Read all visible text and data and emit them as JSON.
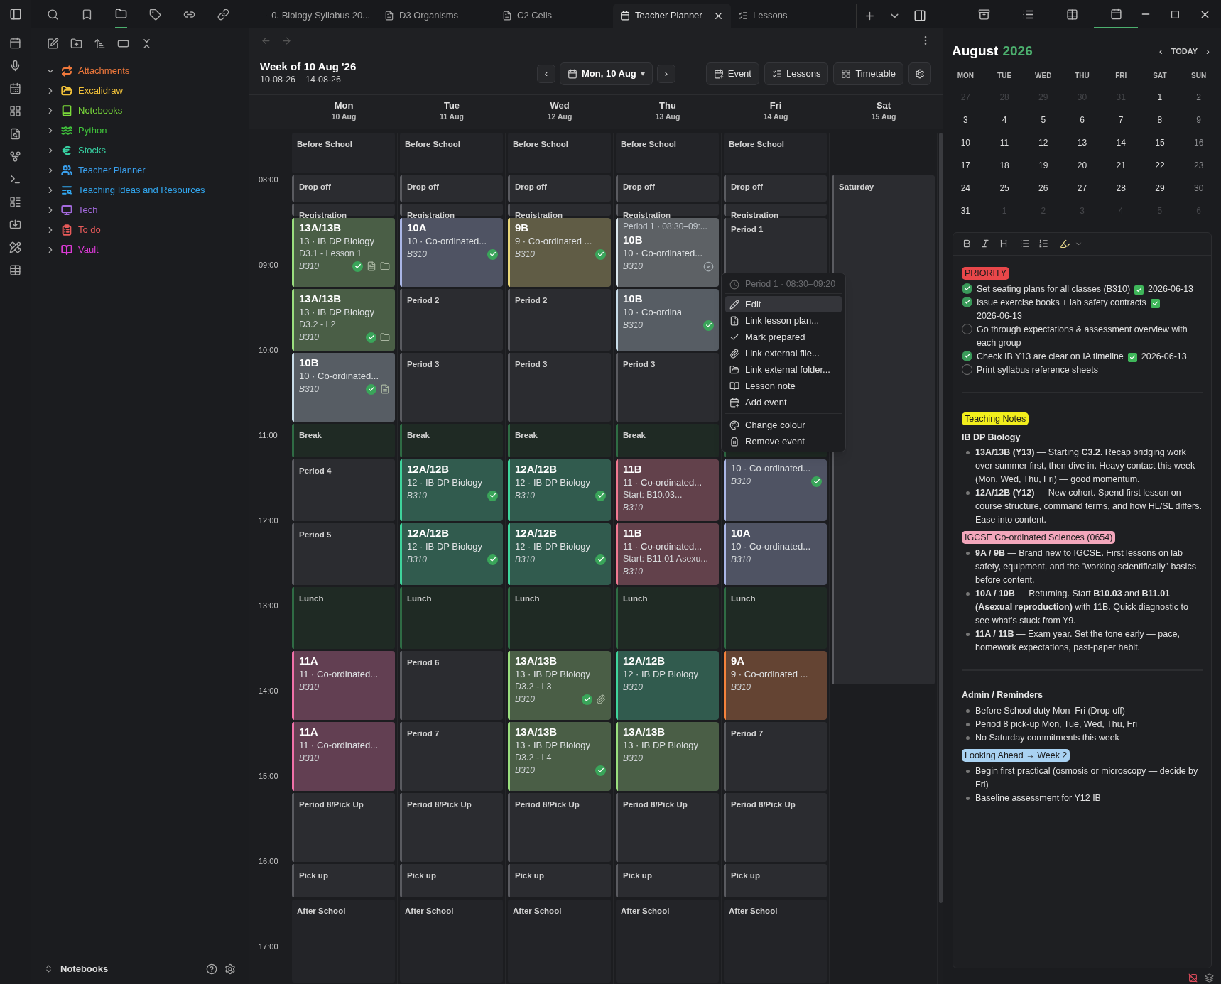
{
  "sidebar": {
    "items": [
      {
        "label": "Attachments",
        "kind": "attachments",
        "color": "#f0793c",
        "expanded": true
      },
      {
        "label": "Excalidraw",
        "kind": "folder",
        "color": "#f2c23a",
        "expanded": false
      },
      {
        "label": "Notebooks",
        "kind": "book",
        "color": "#7bdc3a",
        "expanded": false
      },
      {
        "label": "Python",
        "kind": "waves",
        "color": "#40c53c",
        "expanded": false
      },
      {
        "label": "Stocks",
        "kind": "euro",
        "color": "#38d3a4",
        "expanded": false
      },
      {
        "label": "Teacher Planner",
        "kind": "users",
        "color": "#3aa0ee",
        "expanded": false
      },
      {
        "label": "Teaching Ideas and Resources",
        "kind": "list",
        "color": "#32a6ee",
        "expanded": false
      },
      {
        "label": "Tech",
        "kind": "monitor",
        "color": "#a46ade",
        "expanded": false
      },
      {
        "label": "To do",
        "kind": "clipboard",
        "color": "#e85a5a",
        "expanded": false
      },
      {
        "label": "Vault",
        "kind": "bookopen",
        "color": "#dc3ad6",
        "expanded": false
      }
    ],
    "footer": "Notebooks"
  },
  "tabs": [
    {
      "label": "0. Biology Syllabus 20...",
      "kind": "file",
      "selected": false
    },
    {
      "label": "D3 Organisms",
      "kind": "file",
      "selected": false
    },
    {
      "label": "C2 Cells",
      "kind": "file",
      "selected": false
    },
    {
      "label": "Teacher Planner",
      "kind": "calendar",
      "selected": true
    },
    {
      "label": "Lessons",
      "kind": "tasks",
      "selected": false
    }
  ],
  "planner": {
    "title": "Week of 10 Aug '26",
    "range": "10-08-26 – 14-08-26",
    "prev": "‹",
    "date": "Mon, 10 Aug",
    "next": "›",
    "actions": [
      {
        "label": "Event",
        "kind": "event"
      },
      {
        "label": "Lessons",
        "kind": "tasks"
      },
      {
        "label": "Timetable",
        "kind": "grid"
      }
    ],
    "times": [
      "08:00",
      "09:00",
      "10:00",
      "11:00",
      "12:00",
      "13:00",
      "14:00",
      "15:00",
      "16:00",
      "17:00"
    ],
    "days": [
      {
        "name": "Mon",
        "date": "10 Aug",
        "kind": "weekday",
        "slots": [
          {
            "kind": "open",
            "label": "Before School"
          },
          {
            "kind": "duty",
            "label": "Drop off"
          },
          {
            "kind": "duty",
            "label": "Registration"
          },
          {
            "kind": "lesson",
            "title": "13A/13B",
            "subject": "13 · IB DP Biology",
            "detail": "D3.1 - Lesson 1",
            "room": "B310",
            "color": "#9ade7e",
            "prepared": true,
            "lesson_plan": true,
            "folder": true
          },
          {
            "kind": "lesson",
            "title": "13A/13B",
            "subject": "13 · IB DP Biology",
            "detail": "D3.2 - L2",
            "room": "B310",
            "color": "#9ade7e",
            "prepared": true,
            "folder": true
          },
          {
            "kind": "lesson",
            "title": "10B",
            "subject": "10 · Co-ordinated...",
            "room": "B310",
            "color": "#c8dce8",
            "prepared": true,
            "lesson_plan": true
          },
          {
            "kind": "break",
            "label": "Break"
          },
          {
            "kind": "duty",
            "label": "Period 4"
          },
          {
            "kind": "duty",
            "label": "Period 5"
          },
          {
            "kind": "break",
            "label": "Lunch"
          },
          {
            "kind": "lesson",
            "title": "11A",
            "subject": "11 · Co-ordinated...",
            "room": "B310",
            "color": "#f070a8"
          },
          {
            "kind": "lesson",
            "title": "11A",
            "subject": "11 · Co-ordinated...",
            "room": "B310",
            "color": "#f070a8"
          },
          {
            "kind": "duty",
            "label": "Period 8/Pick Up"
          },
          {
            "kind": "duty",
            "label": "Pick up"
          },
          {
            "kind": "open",
            "label": "After School"
          }
        ]
      },
      {
        "name": "Tue",
        "date": "11 Aug",
        "kind": "weekday",
        "slots": [
          {
            "kind": "open",
            "label": "Before School"
          },
          {
            "kind": "duty",
            "label": "Drop off"
          },
          {
            "kind": "duty",
            "label": "Registration"
          },
          {
            "kind": "lesson",
            "title": "10A",
            "subject": "10 · Co-ordinated...",
            "room": "B310",
            "color": "#aab6e6",
            "prepared": true
          },
          {
            "kind": "duty",
            "label": "Period 2"
          },
          {
            "kind": "duty",
            "label": "Period 3"
          },
          {
            "kind": "break",
            "label": "Break"
          },
          {
            "kind": "lesson",
            "title": "12A/12B",
            "subject": "12 · IB DP Biology",
            "room": "B310",
            "color": "#3fd49c",
            "prepared": true
          },
          {
            "kind": "lesson",
            "title": "12A/12B",
            "subject": "12 · IB DP Biology",
            "room": "B310",
            "color": "#3fd49c",
            "prepared": true
          },
          {
            "kind": "break",
            "label": "Lunch"
          },
          {
            "kind": "duty",
            "label": "Period 6"
          },
          {
            "kind": "duty",
            "label": "Period 7"
          },
          {
            "kind": "duty",
            "label": "Period 8/Pick Up"
          },
          {
            "kind": "duty",
            "label": "Pick up"
          },
          {
            "kind": "open",
            "label": "After School"
          }
        ]
      },
      {
        "name": "Wed",
        "date": "12 Aug",
        "kind": "weekday",
        "slots": [
          {
            "kind": "open",
            "label": "Before School"
          },
          {
            "kind": "duty",
            "label": "Drop off"
          },
          {
            "kind": "duty",
            "label": "Registration"
          },
          {
            "kind": "lesson",
            "title": "9B",
            "subject": "9 · Co-ordinated ...",
            "room": "B310",
            "color": "#e8d67a",
            "prepared": true
          },
          {
            "kind": "duty",
            "label": "Period 2"
          },
          {
            "kind": "duty",
            "label": "Period 3"
          },
          {
            "kind": "break",
            "label": "Break"
          },
          {
            "kind": "lesson",
            "title": "12A/12B",
            "subject": "12 · IB DP Biology",
            "room": "B310",
            "color": "#3fd49c",
            "prepared": true
          },
          {
            "kind": "lesson",
            "title": "12A/12B",
            "subject": "12 · IB DP Biology",
            "room": "B310",
            "color": "#3fd49c",
            "prepared": true
          },
          {
            "kind": "break",
            "label": "Lunch"
          },
          {
            "kind": "lesson",
            "title": "13A/13B",
            "subject": "13 · IB DP Biology",
            "detail": "D3.2 - L3",
            "room": "B310",
            "color": "#9ade7e",
            "prepared": true,
            "file": true
          },
          {
            "kind": "lesson",
            "title": "13A/13B",
            "subject": "13 · IB DP Biology",
            "detail": "D3.2 - L4",
            "room": "B310",
            "color": "#9ade7e",
            "prepared": true
          },
          {
            "kind": "duty",
            "label": "Period 8/Pick Up"
          },
          {
            "kind": "duty",
            "label": "Pick up"
          },
          {
            "kind": "open",
            "label": "After School"
          }
        ]
      },
      {
        "name": "Thu",
        "date": "13 Aug",
        "kind": "weekday",
        "slots": [
          {
            "kind": "open",
            "label": "Before School"
          },
          {
            "kind": "duty",
            "label": "Drop off"
          },
          {
            "kind": "duty",
            "label": "Registration"
          },
          {
            "kind": "lesson",
            "header": "Period 1 · 08:30–09:...",
            "title": "10B",
            "subject": "10 · Co-ordinated...",
            "room": "B310",
            "color": "#dce8ee",
            "prepared": false
          },
          {
            "kind": "lesson",
            "title": "10B",
            "subject": "10 · Co-ordina",
            "room": "B310",
            "color": "#c8dce8",
            "prepared": true
          },
          {
            "kind": "duty",
            "label": "Period 3"
          },
          {
            "kind": "break",
            "label": "Break"
          },
          {
            "kind": "lesson",
            "title": "11B",
            "subject": "11 · Co-ordinated...",
            "detail": "Start: B10.03...",
            "room": "B310",
            "color": "#f07890"
          },
          {
            "kind": "lesson",
            "title": "11B",
            "subject": "11 · Co-ordinated...",
            "detail": "Start: B11.01 Asexu...",
            "room": "B310",
            "color": "#f07890"
          },
          {
            "kind": "break",
            "label": "Lunch"
          },
          {
            "kind": "lesson",
            "title": "12A/12B",
            "subject": "12 · IB DP Biology",
            "room": "B310",
            "color": "#3fd49c"
          },
          {
            "kind": "lesson",
            "title": "13A/13B",
            "subject": "13 · IB DP Biology",
            "room": "B310",
            "color": "#9ade7e"
          },
          {
            "kind": "duty",
            "label": "Period 8/Pick Up"
          },
          {
            "kind": "duty",
            "label": "Pick up"
          },
          {
            "kind": "open",
            "label": "After School"
          }
        ]
      },
      {
        "name": "Fri",
        "date": "14 Aug",
        "kind": "weekday",
        "slots": [
          {
            "kind": "open",
            "label": "Before School"
          },
          {
            "kind": "duty",
            "label": "Drop off"
          },
          {
            "kind": "duty",
            "label": "Registration"
          },
          {
            "kind": "duty",
            "label": "Period 1"
          },
          {
            "kind": "covered"
          },
          {
            "kind": "covered"
          },
          {
            "kind": "break"
          },
          {
            "kind": "lesson",
            "subject": "10 · Co-ordinated...",
            "room": "B310",
            "color": "#aab6e6",
            "prepared": true
          },
          {
            "kind": "lesson",
            "title": "10A",
            "subject": "10 · Co-ordinated...",
            "room": "B310",
            "color": "#aab6e6"
          },
          {
            "kind": "break",
            "label": "Lunch"
          },
          {
            "kind": "lesson",
            "title": "9A",
            "subject": "9 · Co-ordinated ...",
            "room": "B310",
            "color": "#f5823c"
          },
          {
            "kind": "duty",
            "label": "Period 7"
          },
          {
            "kind": "duty",
            "label": "Period 8/Pick Up"
          },
          {
            "kind": "duty",
            "label": "Pick up"
          },
          {
            "kind": "open",
            "label": "After School"
          }
        ]
      },
      {
        "name": "Sat",
        "date": "15 Aug",
        "kind": "weekend",
        "slots": [
          {
            "kind": "duty",
            "label": "Saturday"
          }
        ]
      }
    ],
    "menu": {
      "header": "Period 1 · 08:30–09:20",
      "groups": [
        [
          {
            "label": "Edit",
            "kind": "edit",
            "selected": true
          },
          {
            "label": "Link lesson plan...",
            "kind": "plan",
            "selected": false
          },
          {
            "label": "Mark prepared",
            "kind": "check",
            "selected": false
          },
          {
            "label": "Link external file...",
            "kind": "file",
            "selected": false
          },
          {
            "label": "Link external folder...",
            "kind": "folder",
            "selected": false
          },
          {
            "label": "Lesson note",
            "kind": "note",
            "selected": false
          },
          {
            "label": "Add event",
            "kind": "event",
            "selected": false
          }
        ],
        [
          {
            "label": "Change colour",
            "kind": "colour",
            "selected": false
          },
          {
            "label": "Remove event",
            "kind": "remove",
            "selected": false
          }
        ]
      ]
    }
  },
  "calendar": {
    "month": "August",
    "year": "2026",
    "today": "TODAY",
    "prev": "‹",
    "next": "›",
    "weekdays": [
      "MON",
      "TUE",
      "WED",
      "THU",
      "FRI",
      "SAT",
      "SUN"
    ],
    "weeks": [
      [
        {
          "day": "27",
          "kind": "other"
        },
        {
          "day": "28",
          "kind": "other"
        },
        {
          "day": "29",
          "kind": "other"
        },
        {
          "day": "30",
          "kind": "other"
        },
        {
          "day": "31",
          "kind": "other"
        },
        {
          "day": "1",
          "kind": "current"
        },
        {
          "day": "2",
          "kind": "weekend"
        }
      ],
      [
        {
          "day": "3",
          "kind": "current"
        },
        {
          "day": "4",
          "kind": "current"
        },
        {
          "day": "5",
          "kind": "current"
        },
        {
          "day": "6",
          "kind": "current"
        },
        {
          "day": "7",
          "kind": "current"
        },
        {
          "day": "8",
          "kind": "current"
        },
        {
          "day": "9",
          "kind": "weekend"
        }
      ],
      [
        {
          "day": "10",
          "kind": "current"
        },
        {
          "day": "11",
          "kind": "current"
        },
        {
          "day": "12",
          "kind": "current"
        },
        {
          "day": "13",
          "kind": "current"
        },
        {
          "day": "14",
          "kind": "current"
        },
        {
          "day": "15",
          "kind": "current"
        },
        {
          "day": "16",
          "kind": "weekend"
        }
      ],
      [
        {
          "day": "17",
          "kind": "current"
        },
        {
          "day": "18",
          "kind": "current"
        },
        {
          "day": "19",
          "kind": "current"
        },
        {
          "day": "20",
          "kind": "current"
        },
        {
          "day": "21",
          "kind": "current"
        },
        {
          "day": "22",
          "kind": "current"
        },
        {
          "day": "23",
          "kind": "weekend"
        }
      ],
      [
        {
          "day": "24",
          "kind": "current"
        },
        {
          "day": "25",
          "kind": "current"
        },
        {
          "day": "26",
          "kind": "current"
        },
        {
          "day": "27",
          "kind": "current"
        },
        {
          "day": "28",
          "kind": "current"
        },
        {
          "day": "29",
          "kind": "current"
        },
        {
          "day": "30",
          "kind": "weekend"
        }
      ],
      [
        {
          "day": "31",
          "kind": "current"
        },
        {
          "day": "1",
          "kind": "other"
        },
        {
          "day": "2",
          "kind": "other"
        },
        {
          "day": "3",
          "kind": "other"
        },
        {
          "day": "4",
          "kind": "other"
        },
        {
          "day": "5",
          "kind": "other"
        },
        {
          "day": "6",
          "kind": "other"
        }
      ]
    ]
  },
  "note": {
    "blocks": [
      {
        "kind": "tag",
        "text": "PRIORITY",
        "color": "#e8474a"
      },
      {
        "kind": "task",
        "text": "Set seating plans for all classes (B310)",
        "checked": true,
        "date": "2026-06-13"
      },
      {
        "kind": "task",
        "text": "Issue exercise books + lab safety contracts",
        "checked": true,
        "date": "2026-06-13"
      },
      {
        "kind": "task",
        "text": "Go through expectations & assessment overview with each group",
        "checked": false
      },
      {
        "kind": "task",
        "text": "Check IB Y13 are clear on IA timeline",
        "checked": true,
        "date": "2026-06-13"
      },
      {
        "kind": "task",
        "text": "Print syllabus reference sheets",
        "checked": false
      },
      {
        "kind": "divider"
      },
      {
        "kind": "tag",
        "text": "Teaching Notes",
        "color": "#f2ee1c"
      },
      {
        "kind": "heading",
        "text": "IB DP Biology"
      },
      {
        "kind": "bullet",
        "text": "**13A/13B (Y13)** — Starting **C3.2**. Recap bridging work over summer first, then dive in. Heavy contact this week (Mon, Wed, Thu, Fri) — good momentum."
      },
      {
        "kind": "bullet",
        "text": "**12A/12B (Y12)** — New cohort. Spend first lesson on course structure, command terms, and how HL/SL differs. Ease into content."
      },
      {
        "kind": "tag",
        "text": "IGCSE Co-ordinated Sciences (0654)",
        "color": "#f2a6bb"
      },
      {
        "kind": "bullet",
        "text": "**9A / 9B** — Brand new to IGCSE. First lessons on lab safety, equipment, and the \"working scientifically\" basics before content."
      },
      {
        "kind": "bullet",
        "text": "**10A / 10B** — Returning. Start **B10.03** and **B11.01 (Asexual reproduction)** with 11B. Quick diagnostic to see what's stuck from Y9."
      },
      {
        "kind": "bullet",
        "text": "**11A / 11B** — Exam year. Set the tone early — pace, homework expectations, past-paper habit."
      },
      {
        "kind": "divider"
      },
      {
        "kind": "heading",
        "text": "Admin / Reminders"
      },
      {
        "kind": "bullet",
        "text": "Before School duty Mon–Fri (Drop off)"
      },
      {
        "kind": "bullet",
        "text": "Period 8 pick-up Mon, Tue, Wed, Thu, Fri"
      },
      {
        "kind": "bullet",
        "text": "No Saturday commitments this week"
      },
      {
        "kind": "tag",
        "text": "Looking Ahead → Week 2",
        "color": "#a9d2f2"
      },
      {
        "kind": "bullet",
        "text": "Begin first practical (osmosis or microscopy — decide by Fri)"
      },
      {
        "kind": "bullet",
        "text": "Baseline assessment for Y12 IB"
      }
    ]
  }
}
